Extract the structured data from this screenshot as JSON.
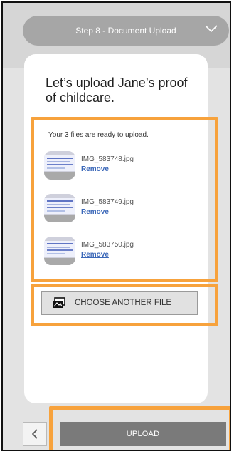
{
  "header": {
    "step_label": "Step 8 - Document Upload"
  },
  "card": {
    "title": "Let’s upload Jane’s proof of childcare.",
    "files_caption": "Your 3 files are ready to upload.",
    "files": [
      {
        "name": "IMG_583748.jpg",
        "action": "Remove"
      },
      {
        "name": "IMG_583749.jpg",
        "action": "Remove"
      },
      {
        "name": "IMG_583750.jpg",
        "action": "Remove"
      }
    ],
    "choose_label": "CHOOSE ANOTHER FILE"
  },
  "footer": {
    "back_icon": "chevron-left-icon",
    "upload_label": "UPLOAD"
  },
  "colors": {
    "highlight": "#f7a23c",
    "upload_button": "#7a7a7a",
    "step_header": "#a6a6a6",
    "link": "#3a67b8"
  }
}
